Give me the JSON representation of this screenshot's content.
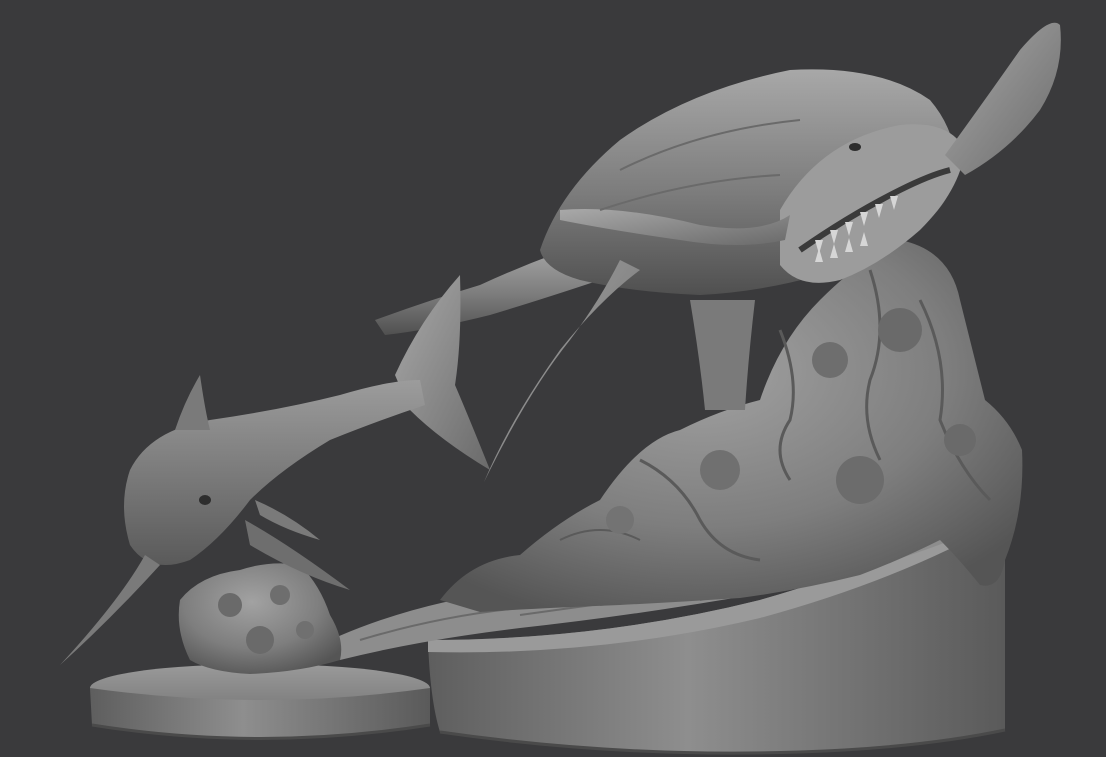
{
  "scene": {
    "background_color": "#3a3a3c",
    "model_color": "#8a8a8a",
    "model_shadow_color": "#4a4a4a",
    "model_highlight_color": "#b4b4b4",
    "subjects": [
      "pliosaur",
      "ichthyosaur",
      "rocky-reef",
      "round-base"
    ]
  }
}
